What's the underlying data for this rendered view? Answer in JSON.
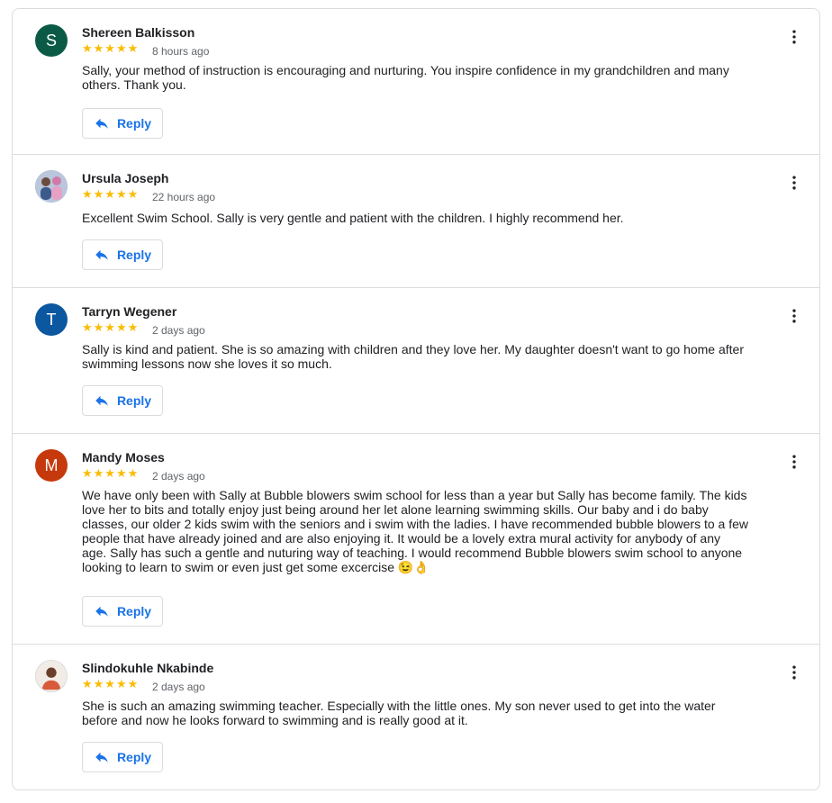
{
  "reply_label": "Reply",
  "colors": {
    "accent": "#1a73e8",
    "star": "#fbbc04"
  },
  "reviews": [
    {
      "name": "Shereen Balkisson",
      "avatar_initial": "S",
      "avatar_color": "#0b5a45",
      "stars": "★★★★★",
      "time": "8 hours ago",
      "text": "Sally, your method of instruction is encouraging and nurturing. You inspire confidence in my grandchildren and many others. Thank you."
    },
    {
      "name": "Ursula Joseph",
      "avatar_initial": "",
      "avatar_color": "#9aa8c2",
      "stars": "★★★★★",
      "time": "22 hours ago",
      "text": "Excellent Swim School. Sally is very gentle and patient with the children. I highly recommend her."
    },
    {
      "name": "Tarryn Wegener",
      "avatar_initial": "T",
      "avatar_color": "#0b57a0",
      "stars": "★★★★★",
      "time": "2 days ago",
      "text": "Sally is kind and patient. She is so amazing with children and they love her. My daughter doesn't want to go home after swimming lessons now she loves it so much."
    },
    {
      "name": "Mandy Moses",
      "avatar_initial": "M",
      "avatar_color": "#c5390c",
      "stars": "★★★★★",
      "time": "2 days ago",
      "text": "We have only been with Sally at Bubble blowers swim school for less than a year but Sally has become family. The kids love her to bits and totally enjoy just being around her let alone learning swimming skills. Our baby and i do baby classes, our older 2 kids swim with the seniors and i swim with the ladies. I have recommended bubble blowers to a few people that have already joined and are also enjoying it. It would be a lovely extra mural activity for anybody of any age. Sally has such a gentle and nuturing way of teaching. I would recommend Bubble blowers swim school to anyone looking to learn to swim or even just get some excercise 😉👌"
    },
    {
      "name": "Slindokuhle Nkabinde",
      "avatar_initial": "",
      "avatar_color": "#e8e0d8",
      "stars": "★★★★★",
      "time": "2 days ago",
      "text": "She is such an amazing swimming teacher. Especially with the little ones. My son never used to get into the water before and now he looks forward to swimming and is really good at it."
    }
  ]
}
